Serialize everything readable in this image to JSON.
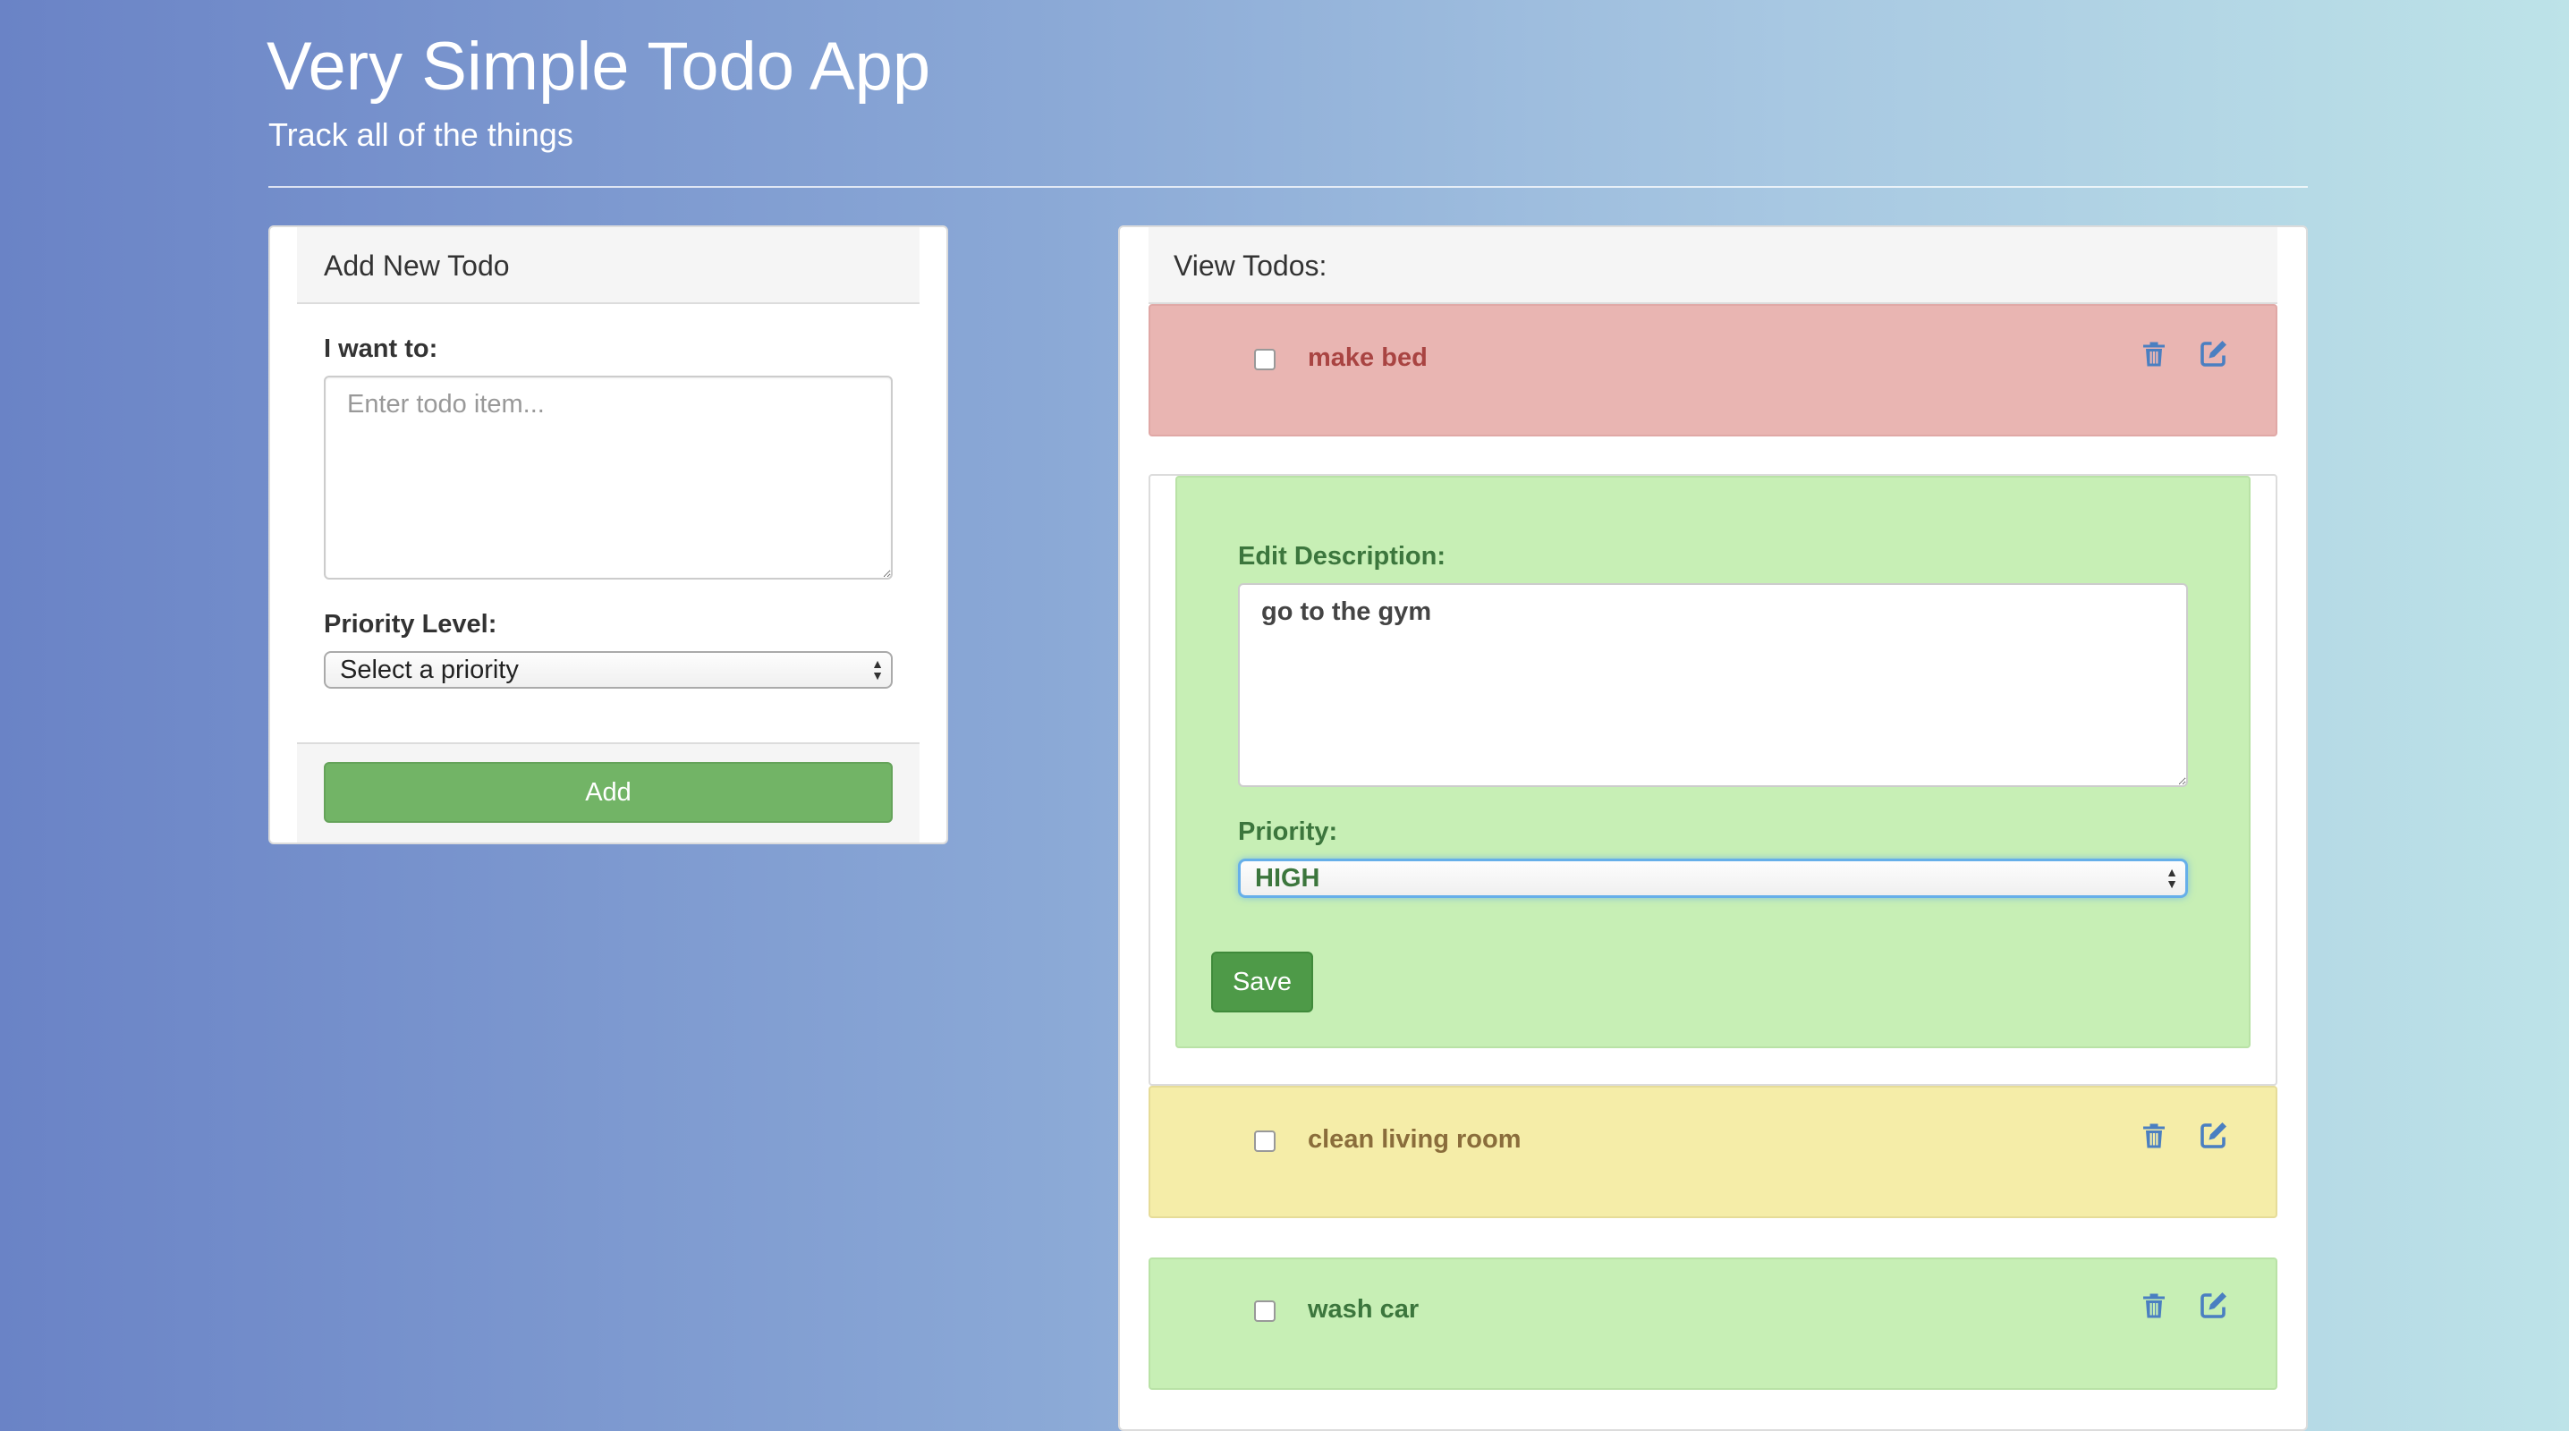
{
  "header": {
    "title": "Very Simple Todo App",
    "subtitle": "Track all of the things"
  },
  "add_panel": {
    "heading": "Add New Todo",
    "input_label": "I want to:",
    "input_placeholder": "Enter todo item...",
    "input_value": "",
    "priority_label": "Priority Level:",
    "priority_selected": "Select a priority",
    "add_button": "Add"
  },
  "view_panel": {
    "heading": "View Todos:",
    "todos": [
      {
        "text": "make bed",
        "priority_color": "#e9b5b2",
        "text_color": "#a94442",
        "completed": false
      },
      {
        "text": "clean living room",
        "priority_color": "#f5eda8",
        "text_color": "#8a6d3b",
        "completed": false
      },
      {
        "text": "wash car",
        "priority_color": "#c7efb5",
        "text_color": "#3c763d",
        "completed": false
      }
    ],
    "edit_form": {
      "description_label": "Edit Description:",
      "description_value": "go to the gym",
      "priority_label": "Priority:",
      "priority_selected": "HIGH",
      "save_button": "Save"
    }
  },
  "icons": {
    "delete": "trash-icon",
    "edit": "edit-icon"
  },
  "colors": {
    "add_button": "#72b466",
    "save_button": "#4e9a48",
    "high": "#e9b5b2",
    "medium": "#f5eda8",
    "low": "#c7efb5"
  }
}
